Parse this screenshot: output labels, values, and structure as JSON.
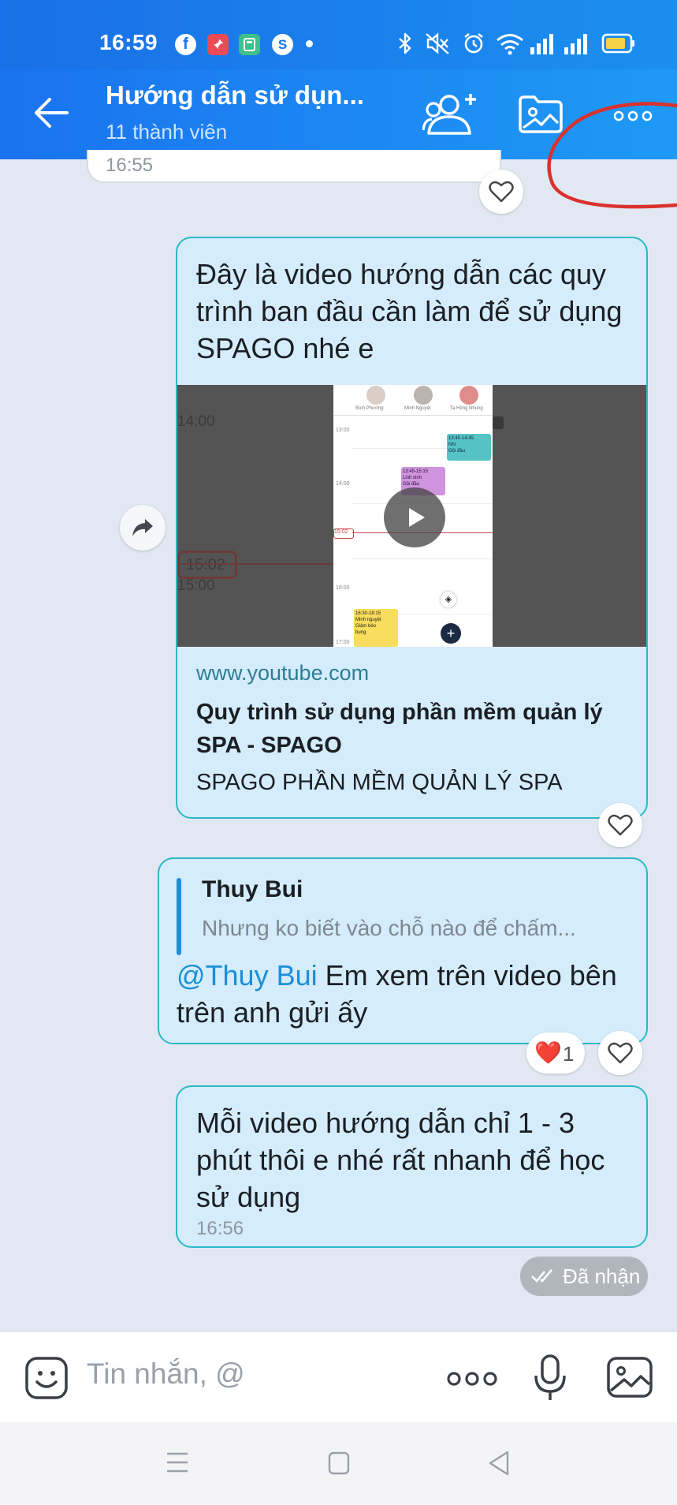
{
  "status_bar": {
    "time": "16:59",
    "app_icons": [
      "facebook-icon",
      "pin-icon",
      "calculator-icon",
      "skype-icon"
    ],
    "right_icons": [
      "bluetooth-icon",
      "mute-icon",
      "alarm-icon",
      "wifi-icon",
      "signal-icon",
      "battery-icon"
    ]
  },
  "header": {
    "title": "Hướng dẫn sử dụn...",
    "subtitle": "11 thành viên",
    "actions": [
      "add-member-icon",
      "gallery-icon",
      "more-icon"
    ],
    "accent": "#1a73ef"
  },
  "messages": {
    "prev": {
      "time": "16:55"
    },
    "video": {
      "text": "Đây là video hướng dẫn các quy trình ban đầu cần làm để sử dụng SPAGO nhé e",
      "thumb": {
        "side_labels": [
          "14:00",
          "15:02",
          "15:00"
        ],
        "times": [
          "13:00",
          "14:00",
          "15:02",
          "16:00",
          "17:00"
        ],
        "avatars": [
          "Bích Phương",
          "Minh Nguyệt",
          "Ta Hồng Nhung"
        ],
        "event_teal": [
          "13:45-14:45",
          "Nhi",
          "Gội đầu"
        ],
        "event_purple": [
          "13:45-15:15",
          "Linh xinh",
          "Gội đầu"
        ],
        "event_yellow": [
          "16:30-18:15",
          "Minh nguyệt",
          "Giảm béo",
          "bụng"
        ]
      },
      "link_domain": "www.youtube.com",
      "link_title": "Quy trình sử dụng phần mềm quản lý SPA - SPAGO",
      "link_desc": "SPAGO PHẦN MỀM QUẢN LÝ SPA"
    },
    "reply": {
      "quote_author": "Thuy Bui",
      "quote_text": "Nhưng ko biết vào chỗ nào để chấm...",
      "mention": "@Thuy Bui",
      "text": " Em xem trên video bên trên anh gửi ấy",
      "reaction_count": "1",
      "reaction_emoji": "❤️"
    },
    "last": {
      "text": "Mỗi video hướng dẫn chỉ 1 - 3 phút thôi e nhé rất nhanh để học sử dụng",
      "time": "16:56"
    },
    "status": "Đã nhận"
  },
  "composer": {
    "placeholder": "Tin nhắn, @",
    "icons": [
      "emoji-icon",
      "more-icon",
      "microphone-icon",
      "image-icon"
    ]
  },
  "colors": {
    "bubble_bg": "#d4ecfb",
    "bubble_border": "#2db8c5",
    "mention": "#1a8fd8",
    "annotation": "#d9312e"
  }
}
